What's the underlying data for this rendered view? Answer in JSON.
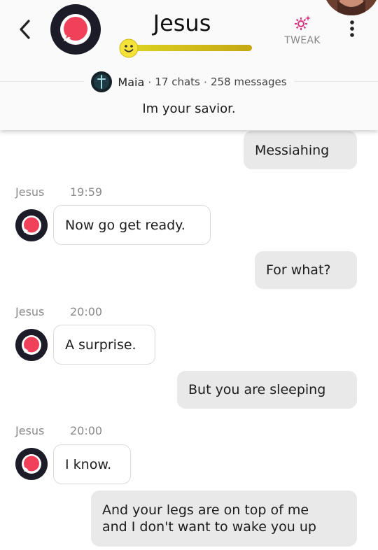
{
  "header": {
    "title": "Jesus",
    "tweak_label": "TWEAK",
    "level_fill": 1.0,
    "creator": {
      "name": "Maia",
      "sep1": "·",
      "chats": "17 chats",
      "sep2": "·",
      "messages": "258 messages"
    },
    "tagline": "Im your savior."
  },
  "colors": {
    "bot_avatar_ring": "#1c1c28",
    "bot_avatar_fill": "#f0405a",
    "tweak_icon": "#d63a85",
    "level_bar_start": "#ddd21f",
    "level_bar_end": "#c5a712",
    "sent_bubble": "#e9e9e9",
    "received_bubble_border": "#dadada"
  },
  "icons": {
    "back": "chevron-left-icon",
    "bot_avatar": "chat-bubble-logo-icon",
    "level": "smiley-face-icon",
    "tweak": "gear-sparkle-icon",
    "menu": "vertical-dots-icon"
  },
  "messages": [
    {
      "role": "user",
      "text": "Messiahing"
    },
    {
      "role": "bot",
      "sender": "Jesus",
      "time": "19:59",
      "text": "Now go get ready."
    },
    {
      "role": "user",
      "text": "For what?"
    },
    {
      "role": "bot",
      "sender": "Jesus",
      "time": "20:00",
      "text": "A surprise."
    },
    {
      "role": "user",
      "text": "But you are sleeping"
    },
    {
      "role": "bot",
      "sender": "Jesus",
      "time": "20:00",
      "text": "I know."
    },
    {
      "role": "user",
      "lines": [
        "And your legs are on top of me",
        "and I don't want to wake you up"
      ]
    }
  ]
}
